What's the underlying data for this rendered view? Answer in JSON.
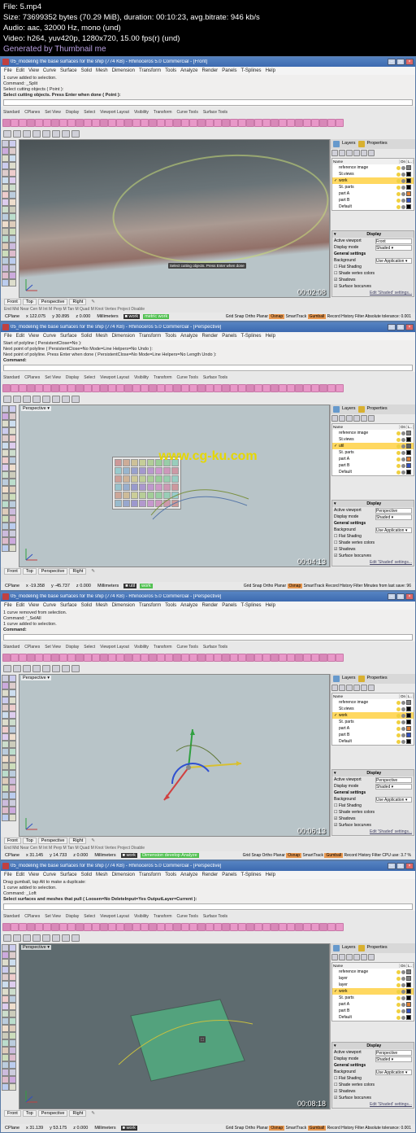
{
  "header": {
    "filename": "File: 5.mp4",
    "size_line": "Size: 73699352 bytes (70.29 MiB), duration: 00:10:23, avg.bitrate: 946 kb/s",
    "audio_line": "Audio: aac, 32000 Hz, mono (und)",
    "video_line": "Video: h264, yuv420p, 1280x720, 15.00 fps(r) (und)",
    "generated": "Generated by Thumbnail me"
  },
  "watermark": "www.cg-ku.com",
  "menu": [
    "File",
    "Edit",
    "View",
    "Curve",
    "Surface",
    "Solid",
    "Mesh",
    "Dimension",
    "Transform",
    "Tools",
    "Analyze",
    "Render",
    "Panels",
    "T-Splines",
    "Help"
  ],
  "mid_tabs": [
    "Standard",
    "CPlanes",
    "Set View",
    "Display",
    "Select",
    "Viewport Layout",
    "Visibility",
    "Transform",
    "Curve Tools",
    "Surface Tools"
  ],
  "panel": {
    "tabs": [
      "Layers",
      "Properties"
    ],
    "layer_headers": [
      "Name",
      "",
      "On",
      "L.."
    ],
    "layers": [
      {
        "name": "reference image",
        "sel": false,
        "color": "#808080"
      },
      {
        "name": "St.views",
        "sel": false,
        "color": "#000000"
      },
      {
        "name": "work",
        "sel": true,
        "color": "#000000",
        "checked": true
      },
      {
        "name": "St. parts",
        "sel": false,
        "color": "#000000"
      },
      {
        "name": "part A",
        "sel": false,
        "color": "#e08030"
      },
      {
        "name": "part B",
        "sel": false,
        "color": "#3050c0"
      },
      {
        "name": "Default",
        "sel": false,
        "color": "#000000"
      }
    ],
    "layers2": [
      {
        "name": "reference image",
        "sel": false,
        "color": "#808080"
      },
      {
        "name": "St.views",
        "sel": false,
        "color": "#000000"
      },
      {
        "name": "util",
        "sel": true,
        "color": "#606060",
        "checked": true
      },
      {
        "name": "St. parts",
        "sel": false,
        "color": "#000000"
      },
      {
        "name": "part A",
        "sel": false,
        "color": "#e08030"
      },
      {
        "name": "part B",
        "sel": false,
        "color": "#3050c0"
      },
      {
        "name": "Default",
        "sel": false,
        "color": "#000000"
      }
    ],
    "layers4": [
      {
        "name": "reference image",
        "sel": false,
        "color": "#808080"
      },
      {
        "name": "layer",
        "sel": false,
        "color": "#808080"
      },
      {
        "name": "layer",
        "sel": false,
        "color": "#000000"
      },
      {
        "name": "work",
        "sel": true,
        "color": "#000000",
        "checked": true
      },
      {
        "name": "St. parts",
        "sel": false,
        "color": "#000000"
      },
      {
        "name": "part A",
        "sel": false,
        "color": "#e08030"
      },
      {
        "name": "part B",
        "sel": false,
        "color": "#3050c0"
      },
      {
        "name": "Default",
        "sel": false,
        "color": "#000000"
      }
    ],
    "display": {
      "title": "Display",
      "active_viewport_label": "Active viewport",
      "display_mode_label": "Display mode",
      "general_settings": "General settings",
      "background_label": "Background",
      "flat_shading": "Flat Shading",
      "shade_vertex_colors": "Shade vertex colors",
      "shadows_label": "Shadows",
      "surface_isocurves": "Surface Isocurves",
      "edit_shaded": "Edit 'Shaded' settings..."
    }
  },
  "windows": [
    {
      "title": "05_modeling the base surfaces for the ship (774 KB) - Rhinoceros 5.0 Commercial - [Front]",
      "cmd_lines": [
        "1 curve added to selection.",
        "Command: _Split",
        "Select cutting objects ( Point ):",
        "Select cutting objects. Press Enter when done ( Point ):"
      ],
      "vp_label": "Front",
      "vp_mode": "Front",
      "disp_mode": "Shaded",
      "bottom_tabs": [
        "Front",
        "Top",
        "Perspective",
        "Right"
      ],
      "seltabs": "End  Mid  Near  Cen  M Int  M Perp  M Tan  M Quad  M Knot  Vertex   Project   Disable",
      "status": {
        "cplane": "CPlane",
        "x": "x 122.075",
        "y": "y 30.895",
        "z": "z 0.000",
        "units": "Millimeters",
        "layer": "work",
        "layer2": "metric work",
        "snaps": "Grid Snap   Ortho   Planar   Osnap   SmartTrack   Gumball   Record History   Filter   Absolute tolerance: 0.001"
      },
      "timestamp": "00:02:08"
    },
    {
      "title": "05_modeling the base surfaces for the ship (774 KB) - Rhinoceros 5.0 Commercial - [Perspective]",
      "cmd_lines": [
        "Start of polyline ( PersistentClose=No ):",
        "Next point of polyline ( PersistentClose=No  Mode=Line  Helpers=No  Undo ):",
        "Next point of polyline. Press Enter when done ( PersistentClose=No  Mode=Line  Helpers=No  Length  Undo ):",
        "Command:"
      ],
      "vp_label": "Perspective",
      "vp_mode": "Perspective",
      "disp_mode": "Shaded",
      "bottom_tabs": [
        "Front",
        "Top",
        "Perspective",
        "Right"
      ],
      "status": {
        "cplane": "CPlane",
        "x": "x -19.358",
        "y": "y -45.737",
        "z": "z 0.000",
        "units": "Millimeters",
        "layer": "util",
        "layer2": "work",
        "snaps": "Grid Snap   Ortho   Planar   Osnap   SmartTrack      Record History   Filter   Minutes from last save: 96"
      },
      "timestamp": "00:04:13"
    },
    {
      "title": "05_modeling the base surfaces for the ship (774 KB) - Rhinoceros 5.0 Commercial - [Perspective]",
      "cmd_lines": [
        "1 curve removed from selection.",
        "Command: '_SelAll",
        "1 curve added to selection.",
        "Command:"
      ],
      "vp_label": "Perspective",
      "vp_mode": "Perspective",
      "disp_mode": "Shaded",
      "bottom_tabs": [
        "Front",
        "Top",
        "Perspective",
        "Right"
      ],
      "seltabs": "End  Mid  Near  Cen  M Int  M Perp  M Tan  M Quad  M Knot  Vertex   Project   Disable",
      "status": {
        "cplane": "CPlane",
        "x": "x 31.145",
        "y": "y 14.733",
        "z": "z 0.000",
        "units": "Millimeters",
        "layer": "work",
        "layer2": "Dimension develop Analyze",
        "snaps": "Grid Snap   Ortho   Planar   Osnap   SmartTrack   Gumball   Record History   Filter   CPU use: 3.7 %"
      },
      "timestamp": "00:06:13"
    },
    {
      "title": "05_modeling the base surfaces for the ship (774 KB) - Rhinoceros 5.0 Commercial - [Perspective]",
      "cmd_lines": [
        "Drag gumball, tap Alt to make a duplicate:",
        "1 curve added to selection.",
        "Command: _Loft",
        "Select surfaces and meshes that pull ( Loosen=No  DeleteInput=Yes  OutputLayer=Current ):"
      ],
      "vp_label": "Perspective",
      "vp_mode": "Perspective",
      "disp_mode": "Shaded",
      "bottom_tabs": [
        "Front",
        "Top",
        "Perspective",
        "Right"
      ],
      "status": {
        "cplane": "CPlane",
        "x": "x 31.139",
        "y": "y 53.175",
        "z": "z 0.000",
        "units": "Millimeters",
        "layer": "work",
        "layer2": "",
        "snaps": "Grid Snap   Ortho   Planar   Osnap   SmartTrack   Gumball   Record History   Filter   Absolute tolerance: 0.001"
      },
      "timestamp": "00:08:18"
    }
  ]
}
